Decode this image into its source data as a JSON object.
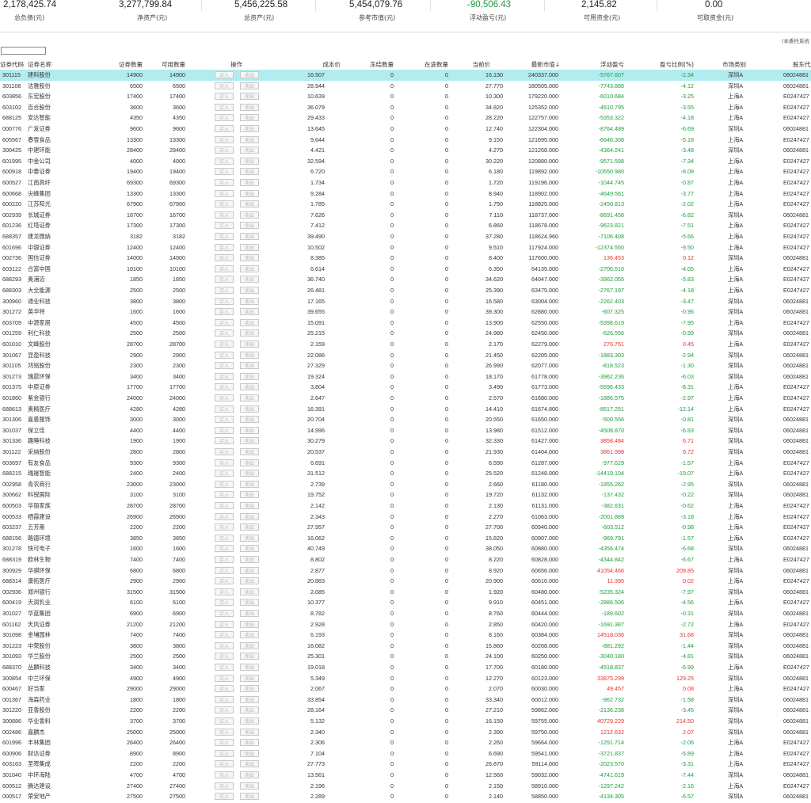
{
  "summary": [
    {
      "value": "2,178,425.74",
      "label": "总负债(元)",
      "color": ""
    },
    {
      "value": "3,277,799.84",
      "label": "净资产(元)",
      "color": ""
    },
    {
      "value": "5,456,225.58",
      "label": "总资产(元)",
      "color": ""
    },
    {
      "value": "5,454,079.76",
      "label": "参考市值(元)",
      "color": ""
    },
    {
      "value": "-90,506.43",
      "label": "浮动盈亏(元)",
      "color": "green"
    },
    {
      "value": "2,145.82",
      "label": "可用资金(元)",
      "color": ""
    },
    {
      "value": "0.00",
      "label": "可取资金(元)",
      "color": ""
    }
  ],
  "note": "(本委托系统",
  "filter": {
    "value": "",
    "placeholder": ""
  },
  "buttons": {
    "buy": "买入",
    "sell": "卖出"
  },
  "columns": [
    "证券代码",
    "证券名称",
    "证券数量",
    "可用数量",
    "操作",
    "成本价",
    "冻结数量",
    "在途数量",
    "当前价",
    "最新市值↓",
    "浮动盈亏",
    "盈亏比例(%)",
    "市场类别",
    "股东代"
  ],
  "rows": [
    [
      "301115",
      "建科股份",
      "14900",
      "14900",
      "16.507",
      "0",
      "0",
      "16.130",
      "240337.000",
      "-5767.607",
      "-2.34",
      "深圳A",
      "06024881"
    ],
    [
      "301108",
      "洁雅股份",
      "6500",
      "6500",
      "28.944",
      "0",
      "0",
      "27.770",
      "180505.000",
      "-7743.888",
      "-4.12",
      "深圳A",
      "06024881"
    ],
    [
      "603856",
      "东宏股份",
      "17400",
      "17400",
      "10.639",
      "0",
      "0",
      "10.300",
      "179220.000",
      "-6010.684",
      "-3.25",
      "上海A",
      "E0247427"
    ],
    [
      "603102",
      "百合股份",
      "3600",
      "3600",
      "36.079",
      "0",
      "0",
      "34.820",
      "125352.000",
      "-4610.795",
      "-3.55",
      "上海A",
      "E0247427"
    ],
    [
      "688125",
      "安达智能",
      "4350",
      "4350",
      "29.433",
      "0",
      "0",
      "28.220",
      "122757.000",
      "-5353.322",
      "-4.18",
      "上海A",
      "E0247427"
    ],
    [
      "000776",
      "广发证券",
      "9600",
      "9600",
      "13.645",
      "0",
      "0",
      "12.740",
      "122304.000",
      "-8764.489",
      "-6.69",
      "深圳A",
      "06024881"
    ],
    [
      "605567",
      "春雪食品",
      "13300",
      "13300",
      "9.644",
      "0",
      "0",
      "9.150",
      "121695.000",
      "-6646.308",
      "-5.18",
      "上海A",
      "E0247427"
    ],
    [
      "300425",
      "中建环能",
      "28400",
      "28400",
      "4.421",
      "0",
      "0",
      "4.270",
      "121268.000",
      "-4364.241",
      "-3.48",
      "深圳A",
      "06024881"
    ],
    [
      "601995",
      "中金公司",
      "4000",
      "4000",
      "32.594",
      "0",
      "0",
      "30.220",
      "120880.000",
      "-9571.598",
      "-7.34",
      "上海A",
      "E0247427"
    ],
    [
      "600918",
      "中泰证券",
      "19400",
      "19400",
      "6.720",
      "0",
      "0",
      "6.180",
      "119892.000",
      "-10550.980",
      "-8.09",
      "上海A",
      "E0247427"
    ],
    [
      "600527",
      "江南高纤",
      "69300",
      "69300",
      "1.734",
      "0",
      "0",
      "1.720",
      "119196.000",
      "-1044.745",
      "-0.87",
      "上海A",
      "E0247427"
    ],
    [
      "600668",
      "尖峰集团",
      "13300",
      "13300",
      "9.284",
      "0",
      "0",
      "8.940",
      "118902.000",
      "-4649.561",
      "-3.77",
      "上海A",
      "E0247427"
    ],
    [
      "600220",
      "江苏阳光",
      "67900",
      "67900",
      "1.785",
      "0",
      "0",
      "1.750",
      "118825.000",
      "-2450.813",
      "-2.02",
      "上海A",
      "E0247427"
    ],
    [
      "002939",
      "长城证券",
      "16700",
      "16700",
      "7.626",
      "0",
      "0",
      "7.110",
      "118737.000",
      "-8691.458",
      "-6.82",
      "深圳A",
      "06024881"
    ],
    [
      "601236",
      "红塔证券",
      "17300",
      "17300",
      "7.412",
      "0",
      "0",
      "6.860",
      "118678.000",
      "-9623.821",
      "-7.51",
      "上海A",
      "E0247427"
    ],
    [
      "688357",
      "建龙微纳",
      "3182",
      "3182",
      "39.490",
      "0",
      "0",
      "37.280",
      "118624.960",
      "-7106.408",
      "-5.66",
      "上海A",
      "E0247427"
    ],
    [
      "601696",
      "中银证券",
      "12400",
      "12400",
      "10.502",
      "0",
      "0",
      "9.510",
      "117924.000",
      "-12374.550",
      "-9.50",
      "上海A",
      "E0247427"
    ],
    [
      "002736",
      "国信证券",
      "14000",
      "14000",
      "8.385",
      "0",
      "0",
      "8.400",
      "117600.000",
      "136.453",
      "0.12",
      "深圳A",
      "06024881"
    ],
    [
      "603122",
      "合富中国",
      "10100",
      "10100",
      "6.614",
      "0",
      "0",
      "6.350",
      "64135.000",
      "-2706.510",
      "-4.05",
      "上海A",
      "E0247427"
    ],
    [
      "688293",
      "奥浦迈",
      "1850",
      "1850",
      "36.740",
      "0",
      "0",
      "34.620",
      "64047.000",
      "-3962.055",
      "-5.83",
      "上海A",
      "E0247427"
    ],
    [
      "688303",
      "大全能源",
      "2500",
      "2500",
      "26.481",
      "0",
      "0",
      "25.390",
      "63475.000",
      "-2767.197",
      "-4.18",
      "上海A",
      "E0247427"
    ],
    [
      "300960",
      "通业科技",
      "3800",
      "3800",
      "17.165",
      "0",
      "0",
      "16.580",
      "63004.000",
      "-2262.403",
      "-3.47",
      "深圳A",
      "06024881"
    ],
    [
      "301272",
      "英华特",
      "1600",
      "1600",
      "39.655",
      "0",
      "0",
      "39.300",
      "62880.000",
      "-607.325",
      "-0.96",
      "深圳A",
      "06024881"
    ],
    [
      "603709",
      "中源家居",
      "4500",
      "4500",
      "15.091",
      "0",
      "0",
      "13.900",
      "62550.000",
      "-5398.619",
      "-7.95",
      "上海A",
      "E0247427"
    ],
    [
      "001259",
      "利仁科技",
      "2500",
      "2500",
      "25.215",
      "0",
      "0",
      "24.980",
      "62450.000",
      "-626.556",
      "-0.99",
      "深圳A",
      "06024881"
    ],
    [
      "601010",
      "文峰股份",
      "28700",
      "28700",
      "2.159",
      "0",
      "0",
      "2.170",
      "62279.000",
      "276.751",
      "0.45",
      "上海A",
      "E0247427"
    ],
    [
      "301067",
      "显盈科技",
      "2900",
      "2900",
      "22.086",
      "0",
      "0",
      "21.450",
      "62205.000",
      "-1883.303",
      "-2.94",
      "深圳A",
      "06024881"
    ],
    [
      "301105",
      "鸿铭股份",
      "2300",
      "2300",
      "27.329",
      "0",
      "0",
      "26.990",
      "62077.000",
      "-818.523",
      "-1.30",
      "深圳A",
      "06024881"
    ],
    [
      "301273",
      "瑞晨环保",
      "3400",
      "3400",
      "19.324",
      "0",
      "0",
      "18.170",
      "61778.000",
      "-3962.236",
      "-6.03",
      "深圳A",
      "06024881"
    ],
    [
      "601375",
      "中原证券",
      "17700",
      "17700",
      "3.804",
      "0",
      "0",
      "3.490",
      "61773.000",
      "-5596.433",
      "-8.31",
      "上海A",
      "E0247427"
    ],
    [
      "601860",
      "紫金银行",
      "24000",
      "24000",
      "2.647",
      "0",
      "0",
      "2.570",
      "61680.000",
      "-1886.575",
      "-2.97",
      "上海A",
      "E0247427"
    ],
    [
      "688613",
      "奥精医疗",
      "4280",
      "4280",
      "16.391",
      "0",
      "0",
      "14.410",
      "61674.800",
      "-8517.251",
      "-12.14",
      "上海A",
      "E0247427"
    ],
    [
      "301306",
      "嘉曼服饰",
      "3000",
      "3000",
      "20.704",
      "0",
      "0",
      "20.550",
      "61650.000",
      "-500.556",
      "-0.81",
      "深圳A",
      "06024881"
    ],
    [
      "301037",
      "保立佳",
      "4400",
      "4400",
      "14.996",
      "0",
      "0",
      "13.980",
      "61512.000",
      "-4508.870",
      "-6.83",
      "深圳A",
      "06024881"
    ],
    [
      "301336",
      "趣睡科技",
      "1900",
      "1900",
      "30.279",
      "0",
      "0",
      "32.330",
      "61427.000",
      "3858.484",
      "6.71",
      "深圳A",
      "06024881"
    ],
    [
      "301122",
      "采纳股份",
      "2800",
      "2800",
      "20.537",
      "0",
      "0",
      "21.930",
      "61404.000",
      "3861.998",
      "6.72",
      "深圳A",
      "06024881"
    ],
    [
      "603697",
      "有友食品",
      "9300",
      "9300",
      "6.691",
      "0",
      "0",
      "6.590",
      "61287.000",
      "-977.629",
      "-1.57",
      "上海A",
      "E0247427"
    ],
    [
      "688215",
      "瑞晟智能",
      "2400",
      "2400",
      "31.512",
      "0",
      "0",
      "25.520",
      "61248.000",
      "-14419.104",
      "-19.07",
      "上海A",
      "E0247427"
    ],
    [
      "002958",
      "青农商行",
      "23000",
      "23000",
      "2.739",
      "0",
      "0",
      "2.660",
      "61180.000",
      "-1855.262",
      "-2.95",
      "深圳A",
      "06024881"
    ],
    [
      "300662",
      "科锐国际",
      "3100",
      "3100",
      "19.752",
      "0",
      "0",
      "19.720",
      "61132.000",
      "-137.432",
      "-0.22",
      "深圳A",
      "06024881"
    ],
    [
      "600503",
      "华丽家族",
      "28700",
      "28700",
      "2.142",
      "0",
      "0",
      "2.130",
      "61131.000",
      "-382.631",
      "-0.62",
      "上海A",
      "E0247427"
    ],
    [
      "600533",
      "栖霞建设",
      "26900",
      "26900",
      "2.343",
      "0",
      "0",
      "2.270",
      "61063.000",
      "-2001.889",
      "-3.18",
      "上海A",
      "E0247427"
    ],
    [
      "603237",
      "五芳斋",
      "2200",
      "2200",
      "27.957",
      "0",
      "0",
      "27.700",
      "60940.000",
      "-603.512",
      "-0.98",
      "上海A",
      "E0247427"
    ],
    [
      "688156",
      "路德环境",
      "3850",
      "3850",
      "16.062",
      "0",
      "0",
      "15.820",
      "60907.000",
      "-969.791",
      "-1.57",
      "上海A",
      "E0247427"
    ],
    [
      "301278",
      "快可电子",
      "1600",
      "1600",
      "40.749",
      "0",
      "0",
      "38.050",
      "60880.000",
      "-4356.474",
      "-6.68",
      "深圳A",
      "06024881"
    ],
    [
      "688319",
      "欧林生物",
      "7400",
      "7400",
      "8.802",
      "0",
      "0",
      "8.220",
      "60828.000",
      "-4344.842",
      "-6.67",
      "上海A",
      "E0247427"
    ],
    [
      "300929",
      "华骐环保",
      "6800",
      "6800",
      "2.877",
      "0",
      "0",
      "8.920",
      "60656.000",
      "41054.466",
      "209.85",
      "深圳A",
      "06024881"
    ],
    [
      "688314",
      "康拓医疗",
      "2900",
      "2900",
      "20.883",
      "0",
      "0",
      "20.900",
      "60610.000",
      "11.395",
      "0.02",
      "上海A",
      "E0247427"
    ],
    [
      "002936",
      "郑州银行",
      "31500",
      "31500",
      "2.085",
      "0",
      "0",
      "1.920",
      "60480.000",
      "-5235.324",
      "-7.97",
      "深圳A",
      "06024881"
    ],
    [
      "600419",
      "天润乳业",
      "6100",
      "6100",
      "10.377",
      "0",
      "0",
      "9.910",
      "60451.000",
      "-2886.506",
      "-4.56",
      "上海A",
      "E0247427"
    ],
    [
      "301027",
      "华蓝集团",
      "6900",
      "6900",
      "8.782",
      "0",
      "0",
      "8.760",
      "60444.000",
      "-189.602",
      "-0.31",
      "深圳A",
      "06024881"
    ],
    [
      "601162",
      "天风证券",
      "21200",
      "21200",
      "2.928",
      "0",
      "0",
      "2.850",
      "60420.000",
      "-1691.387",
      "-2.72",
      "上海A",
      "E0247427"
    ],
    [
      "301098",
      "金埔园林",
      "7400",
      "7400",
      "6.193",
      "0",
      "0",
      "8.160",
      "60384.000",
      "14518.036",
      "31.68",
      "深圳A",
      "06024881"
    ],
    [
      "301223",
      "中荣股份",
      "3800",
      "3800",
      "16.082",
      "0",
      "0",
      "15.860",
      "60268.000",
      "-881.292",
      "-1.44",
      "深圳A",
      "06024881"
    ],
    [
      "301093",
      "华兰股份",
      "2500",
      "2500",
      "25.301",
      "0",
      "0",
      "24.100",
      "60250.000",
      "-3040.180",
      "-4.81",
      "深圳A",
      "06024881"
    ],
    [
      "688370",
      "丛麟科技",
      "3400",
      "3400",
      "19.018",
      "0",
      "0",
      "17.700",
      "60180.000",
      "-4518.837",
      "-6.99",
      "上海A",
      "E0247427"
    ],
    [
      "300854",
      "中兰环保",
      "4900",
      "4900",
      "5.349",
      "0",
      "0",
      "12.270",
      "60123.000",
      "33875.299",
      "129.25",
      "深圳A",
      "06024881"
    ],
    [
      "600467",
      "好当家",
      "29000",
      "29000",
      "2.067",
      "0",
      "0",
      "2.070",
      "60030.000",
      "49.457",
      "0.08",
      "上海A",
      "E0247427"
    ],
    [
      "001367",
      "海森药业",
      "1800",
      "1800",
      "33.854",
      "0",
      "0",
      "33.340",
      "60012.000",
      "-962.732",
      "-1.58",
      "深圳A",
      "06024881"
    ],
    [
      "301220",
      "亚香股份",
      "2200",
      "2200",
      "28.164",
      "0",
      "0",
      "27.210",
      "59862.000",
      "-2136.238",
      "-3.45",
      "深圳A",
      "06024881"
    ],
    [
      "300886",
      "华业香料",
      "3700",
      "3700",
      "5.132",
      "0",
      "0",
      "16.150",
      "59755.000",
      "40729.229",
      "214.50",
      "深圳A",
      "06024881"
    ],
    [
      "002486",
      "嘉麟杰",
      "25000",
      "25000",
      "2.340",
      "0",
      "0",
      "2.390",
      "59750.000",
      "1212.632",
      "2.07",
      "深圳A",
      "06024881"
    ],
    [
      "601996",
      "丰林集团",
      "26400",
      "26400",
      "2.306",
      "0",
      "0",
      "2.260",
      "59664.000",
      "-1251.714",
      "-2.06",
      "上海A",
      "E0247427"
    ],
    [
      "600906",
      "财达证券",
      "8900",
      "8900",
      "7.104",
      "0",
      "0",
      "6.690",
      "59541.000",
      "-3721.837",
      "-5.89",
      "上海A",
      "E0247427"
    ],
    [
      "603163",
      "圣晖集成",
      "2200",
      "2200",
      "27.773",
      "0",
      "0",
      "26.870",
      "59114.000",
      "-2023.570",
      "-3.31",
      "上海A",
      "E0247427"
    ],
    [
      "301040",
      "中环海陆",
      "4700",
      "4700",
      "13.561",
      "0",
      "0",
      "12.560",
      "59032.000",
      "-4741.619",
      "-7.44",
      "深圳A",
      "06024881"
    ],
    [
      "600512",
      "腾达建设",
      "27400",
      "27400",
      "2.196",
      "0",
      "0",
      "2.150",
      "58910.000",
      "-1297.242",
      "-2.16",
      "上海A",
      "E0247427"
    ],
    [
      "000517",
      "荣安地产",
      "27500",
      "27500",
      "2.289",
      "0",
      "0",
      "2.140",
      "58850.000",
      "-4134.305",
      "-6.57",
      "深圳A",
      "06024881"
    ]
  ]
}
